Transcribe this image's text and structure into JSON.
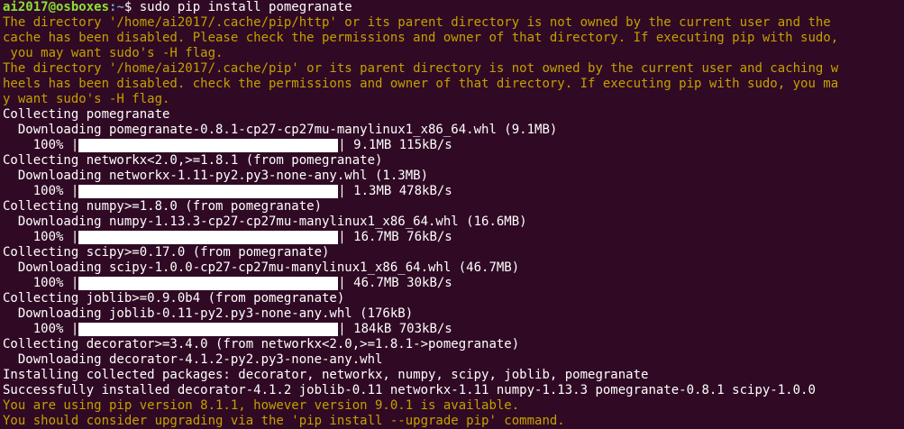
{
  "prompt": {
    "user_host": "ai2017@osboxes",
    "path": ":~",
    "symbol": "$ ",
    "command": "sudo pip install pomegranate"
  },
  "warnings_top": [
    "The directory '/home/ai2017/.cache/pip/http' or its parent directory is not owned by the current user and the",
    "cache has been disabled. Please check the permissions and owner of that directory. If executing pip with sudo,",
    " you may want sudo's -H flag.",
    "The directory '/home/ai2017/.cache/pip' or its parent directory is not owned by the current user and caching w",
    "heels has been disabled. check the permissions and owner of that directory. If executing pip with sudo, you ma",
    "y want sudo's -H flag."
  ],
  "packages": [
    {
      "collecting": "Collecting pomegranate",
      "downloading": "  Downloading pomegranate-0.8.1-cp27-cp27mu-manylinux1_x86_64.whl (9.1MB)",
      "percent": "    100% |",
      "progress": 1.0,
      "stats": "| 9.1MB 115kB/s"
    },
    {
      "collecting": "Collecting networkx<2.0,>=1.8.1 (from pomegranate)",
      "downloading": "  Downloading networkx-1.11-py2.py3-none-any.whl (1.3MB)",
      "percent": "    100% |",
      "progress": 1.0,
      "stats": "| 1.3MB 478kB/s"
    },
    {
      "collecting": "Collecting numpy>=1.8.0 (from pomegranate)",
      "downloading": "  Downloading numpy-1.13.3-cp27-cp27mu-manylinux1_x86_64.whl (16.6MB)",
      "percent": "    100% |",
      "progress": 1.0,
      "stats": "| 16.7MB 76kB/s"
    },
    {
      "collecting": "Collecting scipy>=0.17.0 (from pomegranate)",
      "downloading": "  Downloading scipy-1.0.0-cp27-cp27mu-manylinux1_x86_64.whl (46.7MB)",
      "percent": "    100% |",
      "progress": 1.0,
      "stats": "| 46.7MB 30kB/s"
    },
    {
      "collecting": "Collecting joblib>=0.9.0b4 (from pomegranate)",
      "downloading": "  Downloading joblib-0.11-py2.py3-none-any.whl (176kB)",
      "percent": "    100% |",
      "progress": 1.0,
      "stats": "| 184kB 703kB/s"
    }
  ],
  "decorator": {
    "collecting": "Collecting decorator>=3.4.0 (from networkx<2.0,>=1.8.1->pomegranate)",
    "downloading": "  Downloading decorator-4.1.2-py2.py3-none-any.whl"
  },
  "installing": "Installing collected packages: decorator, networkx, numpy, scipy, joblib, pomegranate",
  "success": "Successfully installed decorator-4.1.2 joblib-0.11 networkx-1.11 numpy-1.13.3 pomegranate-0.8.1 scipy-1.0.0",
  "warnings_bottom": [
    "You are using pip version 8.1.1, however version 9.0.1 is available.",
    "You should consider upgrading via the 'pip install --upgrade pip' command."
  ],
  "colors": {
    "background": "#300a24",
    "warning": "#c4a000",
    "prompt_user": "#8ae234",
    "prompt_path": "#729fcf",
    "text": "#ffffff"
  }
}
